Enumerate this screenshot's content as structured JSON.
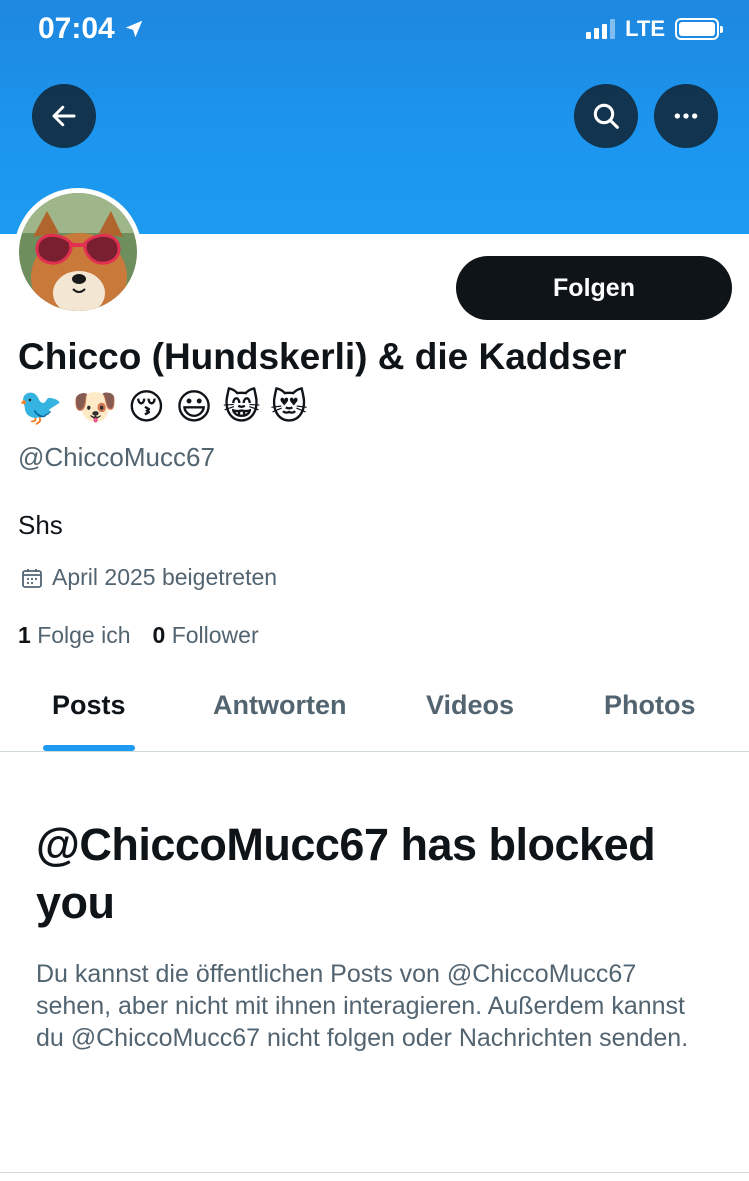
{
  "status_bar": {
    "time": "07:04",
    "network": "LTE"
  },
  "header": {
    "back_icon": "arrow-left-icon",
    "search_icon": "search-icon",
    "more_icon": "more-horizontal-icon",
    "banner_color": "#1d9bf0"
  },
  "profile": {
    "display_name": "Chicco (Hundskerli) & die Kaddser",
    "name_emojis": [
      "🐦",
      "🐶",
      "😚",
      "😃",
      "😸",
      "😻"
    ],
    "handle": "@ChiccoMucc67",
    "bio": "Shs",
    "joined": "April 2025 beigetreten",
    "following_count": "1",
    "following_label": "Folge ich",
    "followers_count": "0",
    "followers_label": "Follower",
    "follow_button": "Folgen"
  },
  "tabs": [
    {
      "label": "Posts",
      "active": true
    },
    {
      "label": "Antworten",
      "active": false
    },
    {
      "label": "Videos",
      "active": false
    },
    {
      "label": "Photos",
      "active": false
    }
  ],
  "blocked": {
    "title": "@ChiccoMucc67 has blocked you",
    "description": "Du kannst die öffentlichen Posts von @ChiccoMucc67 sehen, aber nicht mit ihnen interagieren. Außerdem kannst du @ChiccoMucc67 nicht folgen oder Nachrichten senden."
  },
  "colors": {
    "accent": "#1d9bf0",
    "text_primary": "#0f1419",
    "text_secondary": "#536471"
  }
}
